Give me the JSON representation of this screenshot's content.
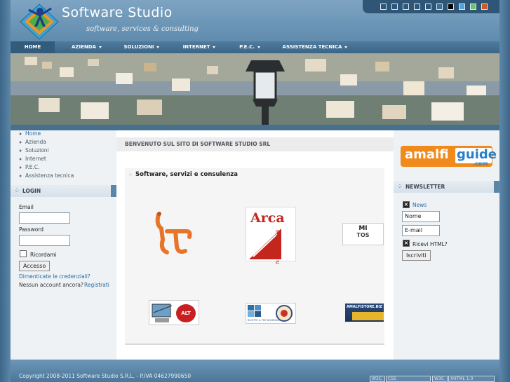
{
  "header": {
    "title": "Software Studio",
    "slogan": "software, services & consulting",
    "tool_colors": [
      "#ffffff",
      "#ffffff",
      "#ffffff",
      "#ffffff",
      "#ffffff",
      "#3a6f9a",
      "#ffffff",
      "#000000",
      "#4fa3d8",
      "#6cc36c",
      "#c85a2a"
    ]
  },
  "nav": {
    "items": [
      {
        "label": "HOME"
      },
      {
        "label": "AZIENDA"
      },
      {
        "label": "SOLUZIONI"
      },
      {
        "label": "INTERNET"
      },
      {
        "label": "P.E.C."
      },
      {
        "label": "ASSISTENZA TECNICA"
      }
    ]
  },
  "left_menu": {
    "items": [
      {
        "label": "Home"
      },
      {
        "label": "Azienda"
      },
      {
        "label": "Soluzioni"
      },
      {
        "label": "Internet"
      },
      {
        "label": "P.E.C."
      },
      {
        "label": "Assistenza tecnica"
      }
    ]
  },
  "login": {
    "heading": "LOGIN",
    "email_label": "Email",
    "password_label": "Password",
    "remember_label": "Ricordami",
    "submit_label": "Accesso",
    "forgot_link": "Dimenticate le credenziali?",
    "no_account_text": "Nessun account ancora?",
    "register_link": "Registrati"
  },
  "main": {
    "page_heading": "BENVENUTO SUL SITO DI SOFTWARE STUDIO SRL",
    "section_title": "Software, servizi e consulenza",
    "logos": {
      "arca_title": "Arca",
      "arca_subtitle": "EVOLUTION",
      "mitos_title": "MI",
      "mitos_title2": "TOS",
      "amalfistore_title": "AMALFISTORE.BIZ",
      "alt_text": "ALT",
      "recipe_caption": "RICETTE IL TRE DOMENICO"
    }
  },
  "right_col": {
    "ad": {
      "brand_left": "amalfi",
      "brand_right": "guide",
      "brand_tld": ".com"
    },
    "newsletter": {
      "heading": "NEWSLETTER",
      "news_label": "News",
      "name_value": "Nome",
      "email_value": "E-mail",
      "html_label": "Ricevi HTML?",
      "submit_label": "Iscriviti"
    }
  },
  "footer": {
    "copyright": "Copyright 2008-2011 Software Studio S.R.L. - P.IVA 04627990650",
    "badges": [
      "W3C",
      "CSS",
      "W3C",
      "XHTML 1.0"
    ]
  }
}
